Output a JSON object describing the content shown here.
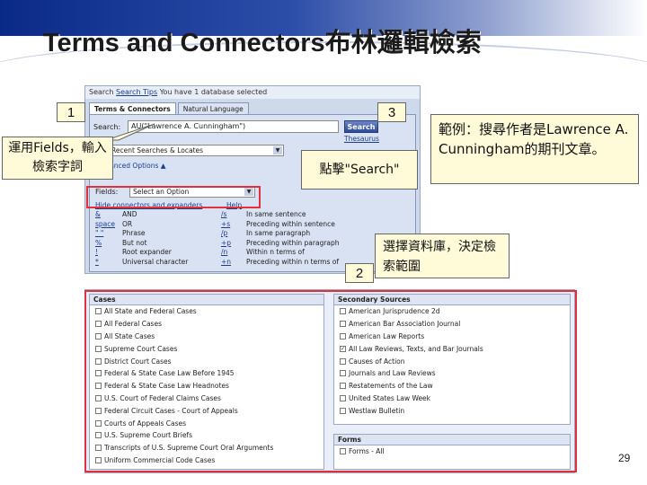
{
  "slide": {
    "title": "Terms and Connectors布林邏輯檢索",
    "page_number": "29"
  },
  "search_form": {
    "topbar_label": "Search",
    "topbar_tips": "Search Tips",
    "topbar_status": "You have 1 database selected",
    "tabs": [
      {
        "label": "Terms & Connectors",
        "active": true
      },
      {
        "label": "Natural Language",
        "active": false
      }
    ],
    "search_label": "Search:",
    "search_value": "AU(\"Lawrence A. Cunningham\")",
    "search_button": "Search",
    "thesaurus_link": "Thesaurus",
    "recent_select": "Recent Searches & Locates",
    "advanced_options": "Advanced Options ▲",
    "fields_label": "Fields:",
    "fields_select": "Select an Option",
    "hide_link": "Hide connectors and expanders",
    "help_link": "Help",
    "connectors": [
      {
        "sym": "&",
        "meaning": "AND",
        "sym2": "/s",
        "meaning2": "In same sentence"
      },
      {
        "sym": "space",
        "meaning": "OR",
        "sym2": "+s",
        "meaning2": "Preceding within sentence"
      },
      {
        "sym": "\" \"",
        "meaning": "Phrase",
        "sym2": "/p",
        "meaning2": "In same paragraph"
      },
      {
        "sym": "%",
        "meaning": "But not",
        "sym2": "+p",
        "meaning2": "Preceding within paragraph"
      },
      {
        "sym": "!",
        "meaning": "Root expander",
        "sym2": "/n",
        "meaning2": "Within n terms of"
      },
      {
        "sym": "*",
        "meaning": "Universal character",
        "sym2": "+n",
        "meaning2": "Preceding within n terms of"
      }
    ]
  },
  "databases": {
    "cases_header": "Cases",
    "cases": [
      {
        "label": "All State and Federal Cases",
        "checked": false
      },
      {
        "label": "All Federal Cases",
        "checked": false
      },
      {
        "label": "All State Cases",
        "checked": false
      },
      {
        "label": "Supreme Court Cases",
        "checked": false
      },
      {
        "label": "District Court Cases",
        "checked": false
      },
      {
        "label": "Federal & State Case Law Before 1945",
        "checked": false
      },
      {
        "label": "Federal & State Case Law Headnotes",
        "checked": false
      },
      {
        "label": "U.S. Court of Federal Claims Cases",
        "checked": false
      },
      {
        "label": "Federal Circuit Cases - Court of Appeals",
        "checked": false
      },
      {
        "label": "Courts of Appeals Cases",
        "checked": false
      },
      {
        "label": "U.S. Supreme Court Briefs",
        "checked": false
      },
      {
        "label": "Transcripts of U.S. Supreme Court Oral Arguments",
        "checked": false
      },
      {
        "label": "Uniform Commercial Code Cases",
        "checked": false
      }
    ],
    "secondary_header": "Secondary Sources",
    "secondary": [
      {
        "label": "American Jurisprudence 2d",
        "checked": false
      },
      {
        "label": "American Bar Association Journal",
        "checked": false
      },
      {
        "label": "American Law Reports",
        "checked": false
      },
      {
        "label": "All Law Reviews, Texts, and Bar Journals",
        "checked": true
      },
      {
        "label": "Causes of Action",
        "checked": false
      },
      {
        "label": "Journals and Law Reviews",
        "checked": false
      },
      {
        "label": "Restatements of the Law",
        "checked": false
      },
      {
        "label": "United States Law Week",
        "checked": false
      },
      {
        "label": "Westlaw Bulletin",
        "checked": false
      }
    ],
    "forms_header": "Forms",
    "forms": [
      {
        "label": "Forms - All",
        "checked": false
      }
    ]
  },
  "callouts": {
    "badge1": "1",
    "badge2": "2",
    "badge3": "3",
    "step1": "運用Fields，輸入檢索字詞",
    "step3": "點擊\"Search\"",
    "step2": "選擇資料庫，決定檢索範圍",
    "example": "範例：搜尋作者是Lawrence A. Cunningham的期刊文章。"
  },
  "colors": {
    "highlight": "#e0323c",
    "callout_bg": "#fffbd9",
    "header_blue": "#0b2a88"
  }
}
